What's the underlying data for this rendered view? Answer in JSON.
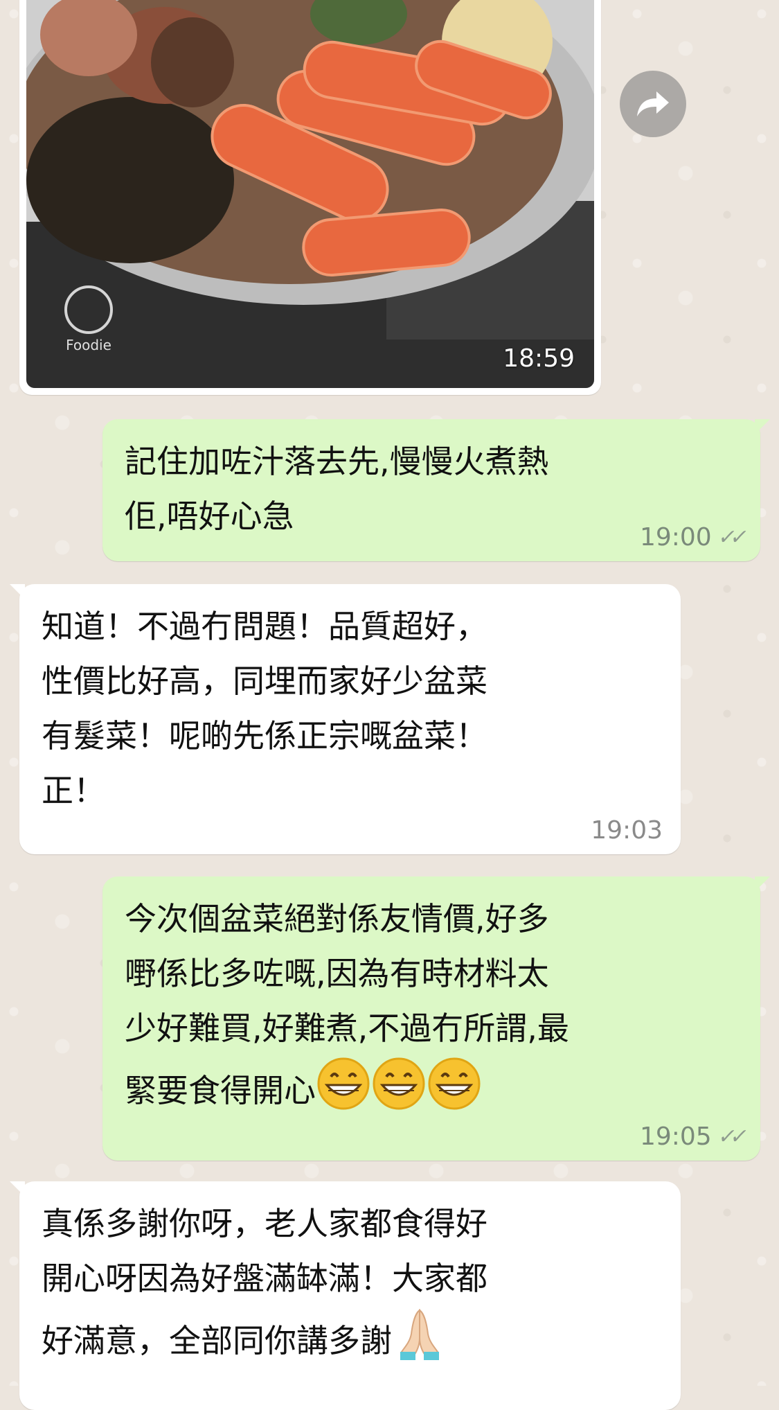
{
  "image_message": {
    "time": "18:59",
    "watermark": "Foodie"
  },
  "messages": [
    {
      "direction": "out",
      "text": "記住加咗汁落去先,慢慢火煮熱\n佢,唔好心急",
      "time": "19:00",
      "status": "read"
    },
    {
      "direction": "in",
      "text": "知道！不過冇問題！品質超好，\n性價比好高，同埋而家好少盆菜\n有髮菜！呢啲先係正宗嘅盆菜！\n正！",
      "time": "19:03"
    },
    {
      "direction": "out",
      "text": "今次個盆菜絕對係友情價,好多\n嘢係比多咗嘅,因為有時材料太\n少好難買,好難煮,不過冇所謂,最\n緊要食得開心",
      "emoji_name": "grinning-face-emoji",
      "emoji_count": 3,
      "time": "19:05",
      "status": "read"
    },
    {
      "direction": "in",
      "text": "真係多謝你呀，老人家都食得好\n開心呀因為好盤滿缽滿！大家都\n好滿意，全部同你講多謝",
      "emoji_name": "folded-hands-emoji"
    }
  ],
  "colors": {
    "outgoing_bubble": "#dcf8c6",
    "incoming_bubble": "#ffffff",
    "wallpaper": "#ece5dd"
  }
}
